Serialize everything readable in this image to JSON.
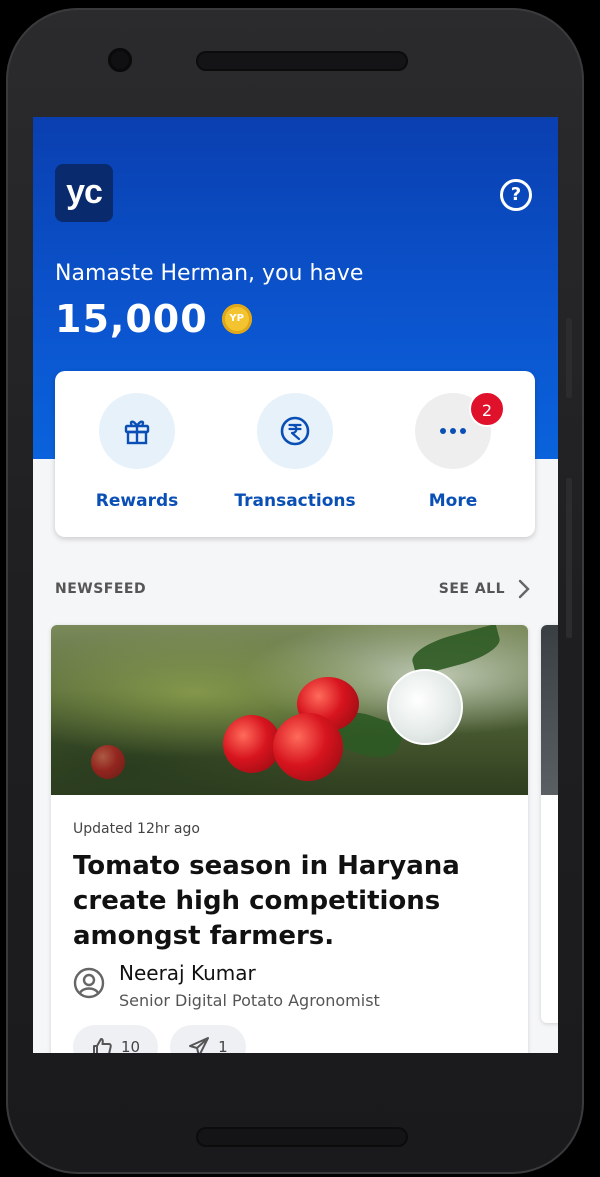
{
  "app": {
    "logo_text": "yc",
    "help_icon": "help-circle-icon",
    "greeting": "Namaste Herman, you have",
    "points": "15,000",
    "coin_label": "YP"
  },
  "actions": [
    {
      "label": "Rewards",
      "icon": "gift-icon"
    },
    {
      "label": "Transactions",
      "icon": "rupee-icon"
    },
    {
      "label": "More",
      "icon": "more-dots-icon",
      "badge": "2"
    }
  ],
  "newsfeed": {
    "title": "NEWSFEED",
    "see_all": "SEE ALL"
  },
  "article": {
    "updated": "Updated 12hr ago",
    "headline": "Tomato season in Haryana create high competitions amongst farmers.",
    "author_name": "Neeraj Kumar",
    "author_role": "Senior Digital Potato Agronomist",
    "likes": "10",
    "shares": "1"
  },
  "colors": {
    "brand_blue": "#0b55cf",
    "accent_text": "#0a4fb5",
    "badge_red": "#e0112a",
    "coin_gold": "#f4c430"
  }
}
